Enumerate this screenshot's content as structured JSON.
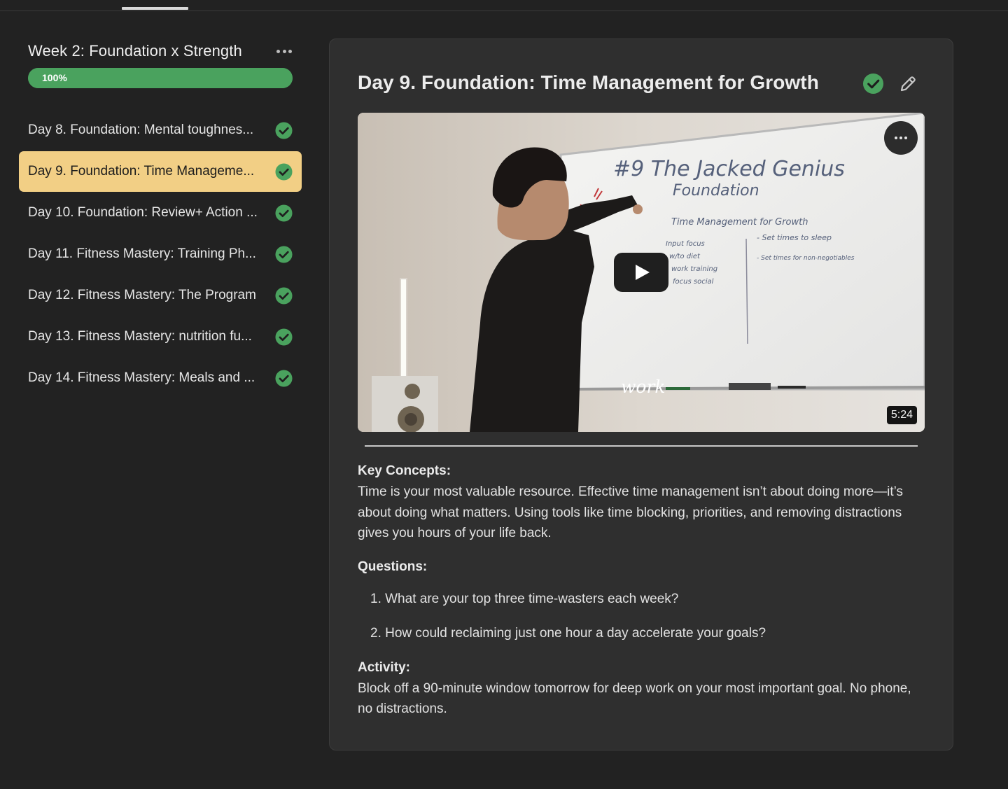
{
  "sidebar": {
    "title": "Week 2: Foundation x Strength",
    "progress": {
      "value": 1.0,
      "label": "100%"
    },
    "lessons": [
      {
        "label": "Day 8. Foundation: Mental toughnes...",
        "completed": true,
        "active": false
      },
      {
        "label": "Day 9. Foundation: Time Manageme...",
        "completed": true,
        "active": true
      },
      {
        "label": "Day 10. Foundation: Review+ Action ...",
        "completed": true,
        "active": false
      },
      {
        "label": "Day 11. Fitness Mastery: Training Ph...",
        "completed": true,
        "active": false
      },
      {
        "label": "Day 12. Fitness Mastery: The Program",
        "completed": true,
        "active": false
      },
      {
        "label": "Day 13. Fitness Mastery: nutrition fu...",
        "completed": true,
        "active": false
      },
      {
        "label": "Day 14. Fitness Mastery: Meals and ...",
        "completed": true,
        "active": false
      }
    ]
  },
  "lesson": {
    "title": "Day 9. Foundation: Time Management for Growth",
    "completed": true,
    "video": {
      "duration": "5:24",
      "caption": "work",
      "whiteboard": {
        "line1": "#9 The Jacked Genius",
        "line2": "Foundation",
        "line3": "Time Management for Growth",
        "note1": "- Set times to sleep",
        "note2": "- Set times for non-negotiables",
        "list": [
          "Input focus",
          "w/to diet",
          "work training",
          "focus social"
        ]
      }
    },
    "key_concepts_heading": "Key Concepts:",
    "key_concepts_text": "Time is your most valuable resource. Effective time management isn’t about doing more—it’s about doing what matters. Using tools like time blocking, priorities, and removing distractions gives you hours of your life back.",
    "questions_heading": "Questions:",
    "questions": [
      "1. What are your top three time-wasters each week?",
      "2. How could reclaiming just one hour a day accelerate your goals?"
    ],
    "activity_heading": "Activity:",
    "activity_text": "Block off a 90-minute window tomorrow for deep work on your most important goal. No phone, no distractions."
  },
  "colors": {
    "background": "#222222",
    "card": "#2f2f2f",
    "accent_green": "#4aa25e",
    "active_item": "#f2cf85"
  },
  "icons": {
    "check": "check-circle-icon",
    "edit": "pencil-icon",
    "more": "more-horizontal-icon",
    "play": "play-icon"
  }
}
